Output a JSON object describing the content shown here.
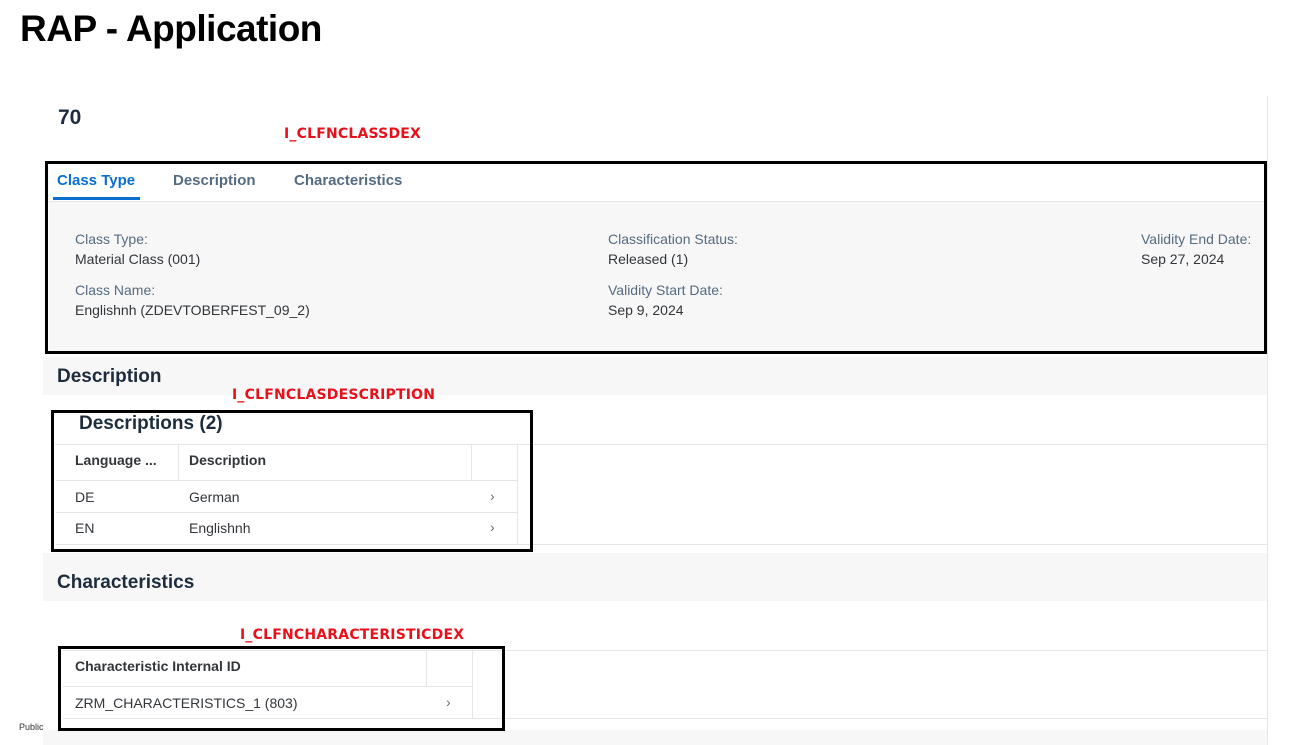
{
  "slide": {
    "title": "RAP - Application",
    "footer": "Public"
  },
  "object": {
    "title": "70"
  },
  "annotations": {
    "class_entity": "I_CLFNCLASSDEX",
    "description_entity": "I_CLFNCLASDESCRIPTION",
    "characteristic_entity": "I_CLFNCHARACTERISTICDEX"
  },
  "tabs": [
    {
      "label": "Class Type",
      "active": true
    },
    {
      "label": "Description",
      "active": false
    },
    {
      "label": "Characteristics",
      "active": false
    }
  ],
  "header_fields": {
    "class_type_label": "Class Type:",
    "class_type_value": "Material Class (001)",
    "class_name_label": "Class Name:",
    "class_name_value": "Englishnh (ZDEVTOBERFEST_09_2)",
    "classification_status_label": "Classification Status:",
    "classification_status_value": "Released (1)",
    "validity_start_label": "Validity Start Date:",
    "validity_start_value": "Sep 9, 2024",
    "validity_end_label": "Validity End Date:",
    "validity_end_value": "Sep 27, 2024"
  },
  "description_section": {
    "title": "Description",
    "table_title": "Descriptions (2)",
    "columns": [
      "Language ...",
      "Description"
    ],
    "rows": [
      {
        "language": "DE",
        "description": "German"
      },
      {
        "language": "EN",
        "description": "Englishnh"
      }
    ],
    "row_chevron": "›"
  },
  "characteristics_section": {
    "title": "Characteristics",
    "columns": [
      "Characteristic Internal ID"
    ],
    "rows": [
      {
        "id": "ZRM_CHARACTERISTICS_1 (803)"
      }
    ],
    "row_chevron": "›"
  },
  "colors": {
    "accent": "#0a6ed1",
    "annotation": "#e8101a"
  }
}
